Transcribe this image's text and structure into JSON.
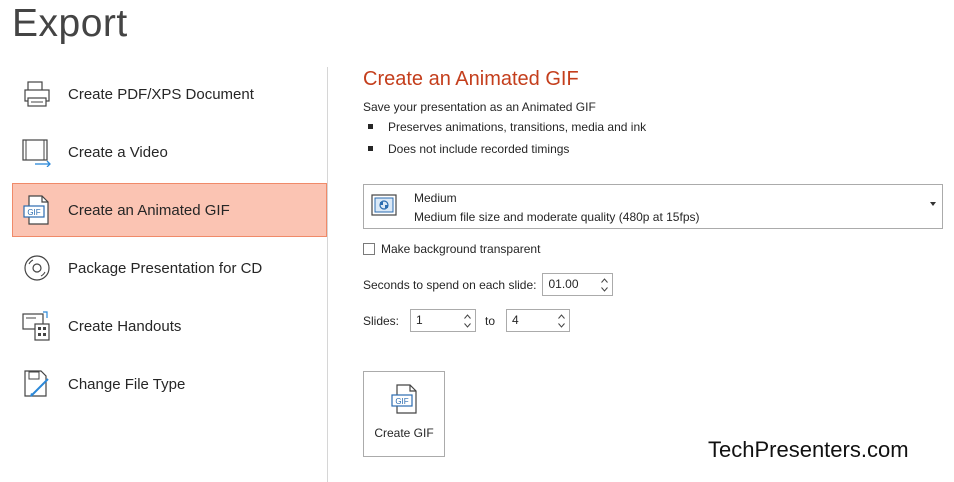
{
  "page": {
    "title": "Export"
  },
  "nav": {
    "items": [
      {
        "label": "Create PDF/XPS Document",
        "icon": "pdf-document-icon",
        "selected": false
      },
      {
        "label": "Create a Video",
        "icon": "video-icon",
        "selected": false
      },
      {
        "label": "Create an Animated GIF",
        "icon": "gif-icon",
        "selected": true
      },
      {
        "label": "Package Presentation for CD",
        "icon": "cd-icon",
        "selected": false
      },
      {
        "label": "Create Handouts",
        "icon": "handouts-icon",
        "selected": false
      },
      {
        "label": "Change File Type",
        "icon": "change-file-type-icon",
        "selected": false
      }
    ],
    "selected_color": "#fbc4b3",
    "selected_border": "#f08a69"
  },
  "pane": {
    "title": "Create an Animated GIF",
    "title_color": "#c43e1c",
    "description": "Save your presentation as an Animated GIF",
    "bullets": [
      "Preserves animations, transitions, media and ink",
      "Does not include recorded timings"
    ],
    "quality": {
      "title": "Medium",
      "subtitle": "Medium file size and moderate quality (480p at 15fps)",
      "icon": "quality-icon"
    },
    "transparent": {
      "label": "Make background transparent",
      "checked": false
    },
    "seconds": {
      "label": "Seconds to spend on each slide:",
      "value": "01.00"
    },
    "slides": {
      "label": "Slides:",
      "from": "1",
      "to_label": "to",
      "to": "4"
    },
    "create_button": {
      "label": "Create GIF",
      "icon": "gif-file-icon"
    }
  },
  "watermark": "TechPresenters.com"
}
